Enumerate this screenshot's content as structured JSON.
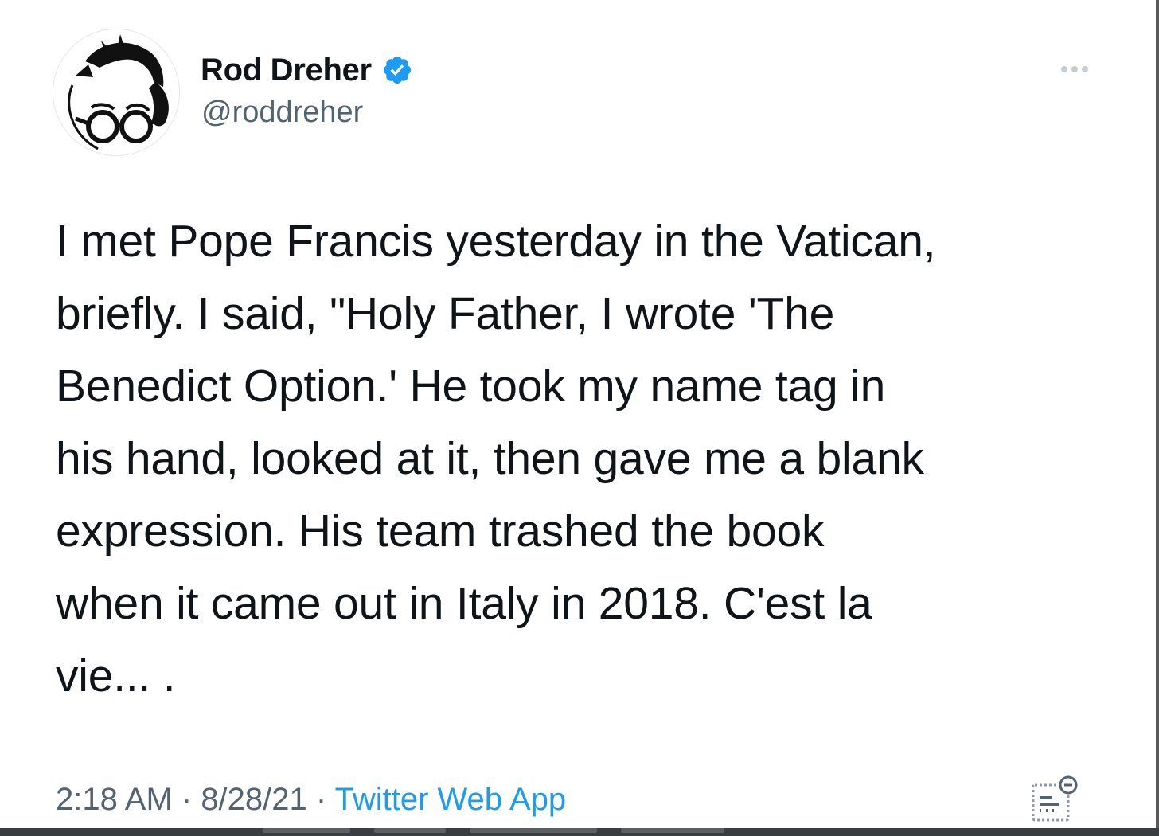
{
  "tweet": {
    "author": {
      "display_name": "Rod Dreher",
      "handle": "@roddreher",
      "avatar_icon": "avatar-caricature-with-glasses",
      "verified_icon": "verified-badge-icon",
      "verified_color": "#1d9bf0"
    },
    "more_icon": "more-options-icon",
    "text": "I met Pope Francis yesterday in the Vatican,\nbriefly. I said, \"Holy Father, I wrote 'The\nBenedict Option.' He took my name tag in\nhis hand, looked at it, then gave me a blank\nexpression. His team trashed the book\nwhen it came out in Italy in 2018. C'est la\nvie... .",
    "meta": {
      "time": "2:18 AM",
      "separator": " · ",
      "date": "8/28/21",
      "source": "Twitter Web App",
      "source_color": "#1d9bf0"
    },
    "analytics_icon": "tweet-analytics-icon"
  }
}
